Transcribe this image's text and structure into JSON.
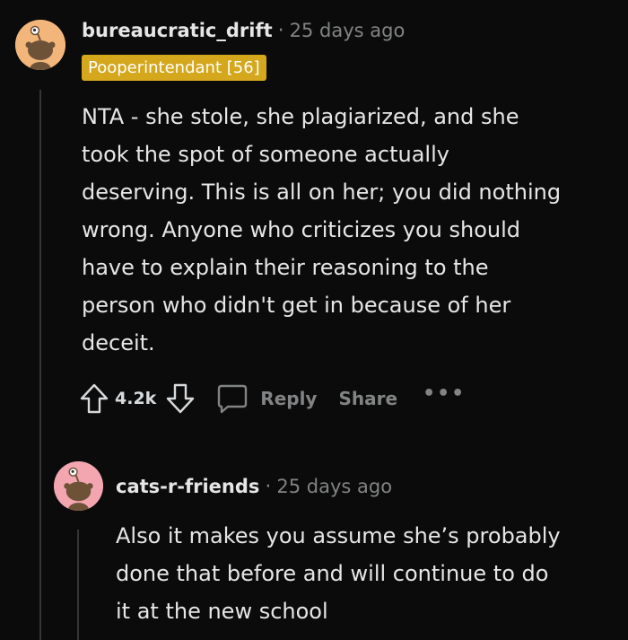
{
  "comment": {
    "author": "bureaucratic_drift",
    "separator": "·",
    "time": "25 days ago",
    "flair": "Pooperintendant [56]",
    "avatar_icon": "snoo-avatar-icon",
    "avatar_color": "#f2b67b",
    "body_lines": [
      "NTA - she stole, she plagiarized, and she",
      "took the spot of someone actually",
      "deserving. This is all on her; you did nothing",
      "wrong. Anyone who criticizes you should",
      "have to explain their reasoning to the",
      "person who didn't get in because of her",
      "deceit."
    ],
    "score": "4.2k",
    "reply_label": "Reply",
    "share_label": "Share",
    "more_label": "•••"
  },
  "reply": {
    "author": "cats-r-friends",
    "separator": "·",
    "time": "25 days ago",
    "avatar_icon": "snoo-avatar-icon",
    "avatar_color": "#f3a6b0",
    "body_lines": [
      "Also it makes you assume she’s probably",
      "done that before and will continue to do",
      "it at the new school"
    ]
  },
  "colors": {
    "background": "#0b0b0b",
    "flair_bg": "#d4a71d",
    "muted_text": "#818384",
    "text": "#e6e6e6"
  }
}
